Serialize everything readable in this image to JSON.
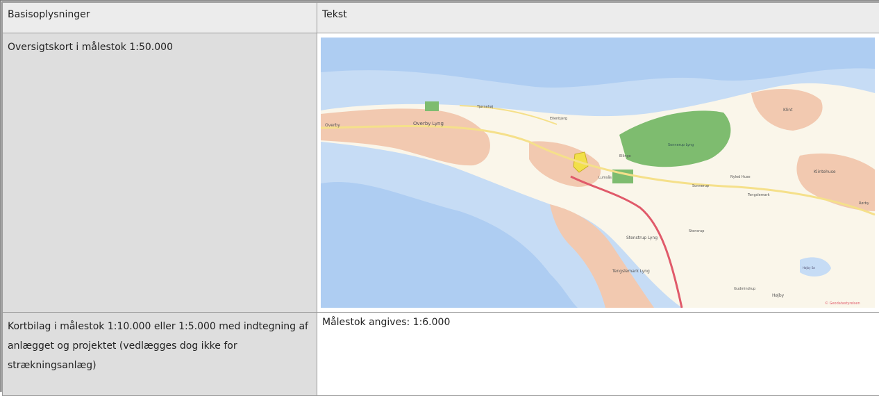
{
  "table": {
    "headers": [
      "Basisoplysninger",
      "Tekst"
    ],
    "rows": [
      {
        "label": "Oversigtskort i målestok 1:50.000",
        "value": ""
      },
      {
        "label": "Kortbilag i målestok 1:10.000 eller 1:5.000 med indtegning af anlægget og projektet (vedlægges dog ikke for strækningsanlæg)",
        "value": "Målestok angives: 1:6.000"
      }
    ]
  },
  "map": {
    "place_labels": [
      "Overby",
      "Overby Lyng",
      "Tjørnehøj",
      "Ellenbjerg",
      "Klint",
      "Sonnerup Lyng",
      "Ellinge",
      "Lumsås",
      "Nyled Huse",
      "Sonnerup",
      "Klintehuse",
      "Tengslemark",
      "Stenstrup Lyng",
      "Stensrup",
      "Tengslemark Lyng",
      "Gudmindrup",
      "Højby",
      "Højby Sø",
      "Rørby"
    ],
    "attribution": "© Geodatastyrelsen",
    "colors": {
      "sea": "#c6dcf5",
      "deep_sea": "#aecdf2",
      "land": "#faf6ea",
      "urban": "#f2c9b0",
      "forest": "#7ebc6f",
      "highlight": "#f2e04a",
      "road_main": "#e05a6a",
      "road_minor": "#f5e08a"
    }
  }
}
